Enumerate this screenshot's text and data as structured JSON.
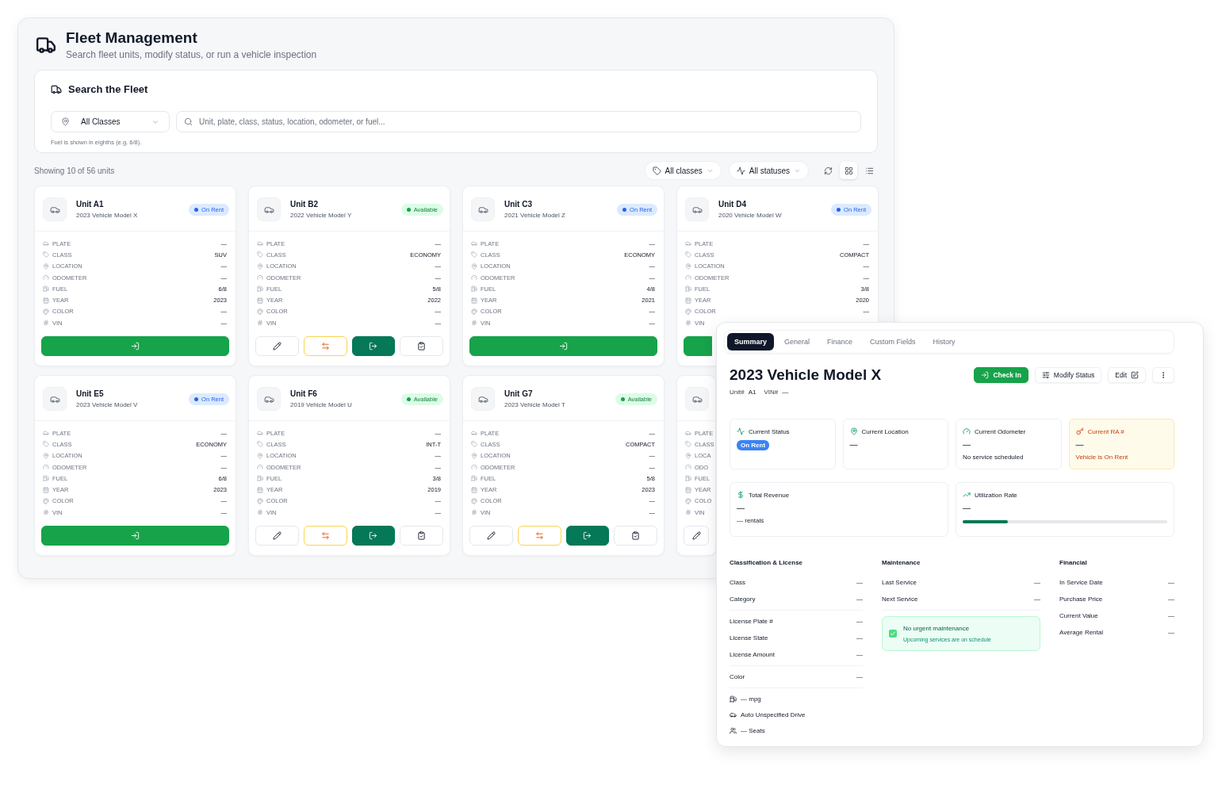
{
  "header": {
    "title": "Fleet Management",
    "subtitle": "Search fleet units, modify status, or run a vehicle inspection"
  },
  "search": {
    "title": "Search the Fleet",
    "class_select": "All Classes",
    "placeholder": "Unit, plate, class, status, location, odometer, or fuel...",
    "hint": "Fuel is shown in eighths (e.g. 6/8)."
  },
  "toolbar": {
    "count": "Showing 10 of 56 units",
    "filters": [
      {
        "kind": "class",
        "label": "All classes"
      },
      {
        "kind": "status",
        "label": "All statuses"
      }
    ],
    "views": [
      {
        "kind": "grid",
        "selected": true
      },
      {
        "kind": "list",
        "selected": false
      }
    ]
  },
  "cards": [
    {
      "title": "Unit A1",
      "subtitle": "2023 Vehicle Model X",
      "status": {
        "label": "On Rent",
        "kind": "on_rent"
      },
      "fields": [
        {
          "label": "PLATE",
          "value": "—"
        },
        {
          "label": "CLASS",
          "value": "SUV"
        },
        {
          "label": "LOCATION",
          "value": "—"
        },
        {
          "label": "ODOMETER",
          "value": "—"
        },
        {
          "label": "FUEL",
          "value": "6/8"
        },
        {
          "label": "YEAR",
          "value": "2023"
        },
        {
          "label": "COLOR",
          "value": "—"
        },
        {
          "label": "VIN",
          "value": "—"
        }
      ],
      "actions": [
        {
          "kind": "check_in"
        }
      ]
    },
    {
      "title": "Unit B2",
      "subtitle": "2022 Vehicle Model Y",
      "status": {
        "label": "Available",
        "kind": "available"
      },
      "fields": [
        {
          "label": "PLATE",
          "value": "—"
        },
        {
          "label": "CLASS",
          "value": "ECONOMY"
        },
        {
          "label": "LOCATION",
          "value": "—"
        },
        {
          "label": "ODOMETER",
          "value": "—"
        },
        {
          "label": "FUEL",
          "value": "5/8"
        },
        {
          "label": "YEAR",
          "value": "2022"
        },
        {
          "label": "COLOR",
          "value": "—"
        },
        {
          "label": "VIN",
          "value": "—"
        }
      ],
      "actions": [
        {
          "kind": "edit"
        },
        {
          "kind": "swap"
        },
        {
          "kind": "check_out"
        },
        {
          "kind": "inspect"
        }
      ]
    },
    {
      "title": "Unit C3",
      "subtitle": "2021 Vehicle Model Z",
      "status": {
        "label": "On Rent",
        "kind": "on_rent"
      },
      "fields": [
        {
          "label": "PLATE",
          "value": "—"
        },
        {
          "label": "CLASS",
          "value": "ECONOMY"
        },
        {
          "label": "LOCATION",
          "value": "—"
        },
        {
          "label": "ODOMETER",
          "value": "—"
        },
        {
          "label": "FUEL",
          "value": "4/8"
        },
        {
          "label": "YEAR",
          "value": "2021"
        },
        {
          "label": "COLOR",
          "value": "—"
        },
        {
          "label": "VIN",
          "value": "—"
        }
      ],
      "actions": [
        {
          "kind": "check_in"
        }
      ]
    },
    {
      "title": "Unit D4",
      "subtitle": "2020 Vehicle Model W",
      "status": {
        "label": "On Rent",
        "kind": "on_rent"
      },
      "fields": [
        {
          "label": "PLATE",
          "value": "—"
        },
        {
          "label": "CLASS",
          "value": "COMPACT"
        },
        {
          "label": "LOCATION",
          "value": "—"
        },
        {
          "label": "ODOMETER",
          "value": "—"
        },
        {
          "label": "FUEL",
          "value": "3/8"
        },
        {
          "label": "YEAR",
          "value": "2020"
        },
        {
          "label": "COLOR",
          "value": "—"
        },
        {
          "label": "VIN"
        }
      ],
      "actions": [
        {
          "kind": "plain"
        }
      ]
    },
    {
      "title": "Unit E5",
      "subtitle": "2023 Vehicle Model V",
      "status": {
        "label": "On Rent",
        "kind": "on_rent"
      },
      "fields": [
        {
          "label": "PLATE",
          "value": "—"
        },
        {
          "label": "CLASS",
          "value": "ECONOMY"
        },
        {
          "label": "LOCATION",
          "value": "—"
        },
        {
          "label": "ODOMETER",
          "value": "—"
        },
        {
          "label": "FUEL",
          "value": "6/8"
        },
        {
          "label": "YEAR",
          "value": "2023"
        },
        {
          "label": "COLOR",
          "value": "—"
        },
        {
          "label": "VIN",
          "value": "—"
        }
      ],
      "actions": [
        {
          "kind": "check_in"
        }
      ]
    },
    {
      "title": "Unit F6",
      "subtitle": "2019 Vehicle Model U",
      "status": {
        "label": "Available",
        "kind": "available"
      },
      "fields": [
        {
          "label": "PLATE",
          "value": "—"
        },
        {
          "label": "CLASS",
          "value": "INT-T"
        },
        {
          "label": "LOCATION",
          "value": "—"
        },
        {
          "label": "ODOMETER",
          "value": "—"
        },
        {
          "label": "FUEL",
          "value": "3/8"
        },
        {
          "label": "YEAR",
          "value": "2019"
        },
        {
          "label": "COLOR",
          "value": "—"
        },
        {
          "label": "VIN",
          "value": "—"
        }
      ],
      "actions": [
        {
          "kind": "edit"
        },
        {
          "kind": "swap"
        },
        {
          "kind": "check_out"
        },
        {
          "kind": "inspect"
        }
      ]
    },
    {
      "title": "Unit G7",
      "subtitle": "2023 Vehicle Model T",
      "status": {
        "label": "Available",
        "kind": "available"
      },
      "fields": [
        {
          "label": "PLATE",
          "value": "—"
        },
        {
          "label": "CLASS",
          "value": "COMPACT"
        },
        {
          "label": "LOCATION",
          "value": "—"
        },
        {
          "label": "ODOMETER",
          "value": "—"
        },
        {
          "label": "FUEL",
          "value": "5/8"
        },
        {
          "label": "YEAR",
          "value": "2023"
        },
        {
          "label": "COLOR",
          "value": "—"
        },
        {
          "label": "VIN",
          "value": "—"
        }
      ],
      "actions": [
        {
          "kind": "edit"
        },
        {
          "kind": "swap"
        },
        {
          "kind": "check_out"
        },
        {
          "kind": "inspect"
        }
      ]
    },
    {
      "fields": [
        {
          "label": "PLATE"
        },
        {
          "label": "CLASS"
        },
        {
          "label": "LOCA"
        },
        {
          "label": "ODO"
        },
        {
          "label": "FUEL"
        },
        {
          "label": "YEAR"
        },
        {
          "label": "COLO"
        },
        {
          "label": "VIN"
        }
      ],
      "actions": [
        {
          "kind": "edit"
        }
      ]
    }
  ],
  "detail": {
    "tabs": [
      {
        "label": "Summary",
        "selected": true
      },
      {
        "label": "General",
        "selected": false
      },
      {
        "label": "Finance",
        "selected": false
      },
      {
        "label": "Custom Fields",
        "selected": false
      },
      {
        "label": "History",
        "selected": false
      }
    ],
    "title": "2023 Vehicle Model X",
    "actions": [
      {
        "kind": "check_in",
        "label": "Check In"
      },
      {
        "kind": "modify",
        "label": "Modify Status"
      },
      {
        "kind": "edit",
        "label": "Edit"
      },
      {
        "kind": "more"
      }
    ],
    "meta": [
      {
        "label": "Unit#",
        "value": "A1"
      },
      {
        "label": "VIN#",
        "value": "—"
      }
    ],
    "stats": [
      {
        "kind": "status",
        "label": "Current Status",
        "badge": "On Rent"
      },
      {
        "kind": "location",
        "label": "Current Location",
        "value": "—"
      },
      {
        "kind": "odometer",
        "label": "Current Odometer",
        "value": "—",
        "note": "No service scheduled"
      },
      {
        "kind": "ra",
        "label": "Current RA #",
        "value": "—",
        "note": "Vehicle is On Rent"
      }
    ],
    "metrics": [
      {
        "kind": "revenue",
        "label": "Total Revenue",
        "value": "—",
        "note": "— rentals"
      },
      {
        "kind": "utilization",
        "label": "Utilization Rate",
        "value": "—",
        "level": 0.22
      }
    ],
    "sections": [
      {
        "title": "Classification & License",
        "groups": [
          [
            {
              "label": "Class",
              "value": "—"
            },
            {
              "label": "Category",
              "value": "—"
            }
          ],
          [
            {
              "label": "License Plate #",
              "value": "—"
            },
            {
              "label": "License State",
              "value": "—"
            },
            {
              "label": "License Amount",
              "value": "—"
            }
          ],
          [
            {
              "label": "Color",
              "value": "—"
            }
          ]
        ],
        "specs": [
          {
            "kind": "fuel",
            "text": "— mpg"
          },
          {
            "kind": "drive",
            "text": "Auto Unspecified Drive"
          },
          {
            "kind": "seats",
            "text": "— Seats"
          }
        ]
      },
      {
        "title": "Maintenance",
        "groups": [
          [
            {
              "label": "Last Service",
              "value": "—"
            },
            {
              "label": "Next Service",
              "value": "—"
            }
          ]
        ],
        "notice": {
          "title": "No urgent maintenance",
          "text": "Upcoming services are on schedule",
          "checked": true
        }
      },
      {
        "title": "Financial",
        "groups": [
          [
            {
              "label": "In Service Date",
              "value": "—"
            },
            {
              "label": "Purchase Price",
              "value": "—"
            },
            {
              "label": "Current Value",
              "value": "—"
            },
            {
              "label": "Average Rental",
              "value": "—"
            }
          ]
        ]
      }
    ]
  }
}
